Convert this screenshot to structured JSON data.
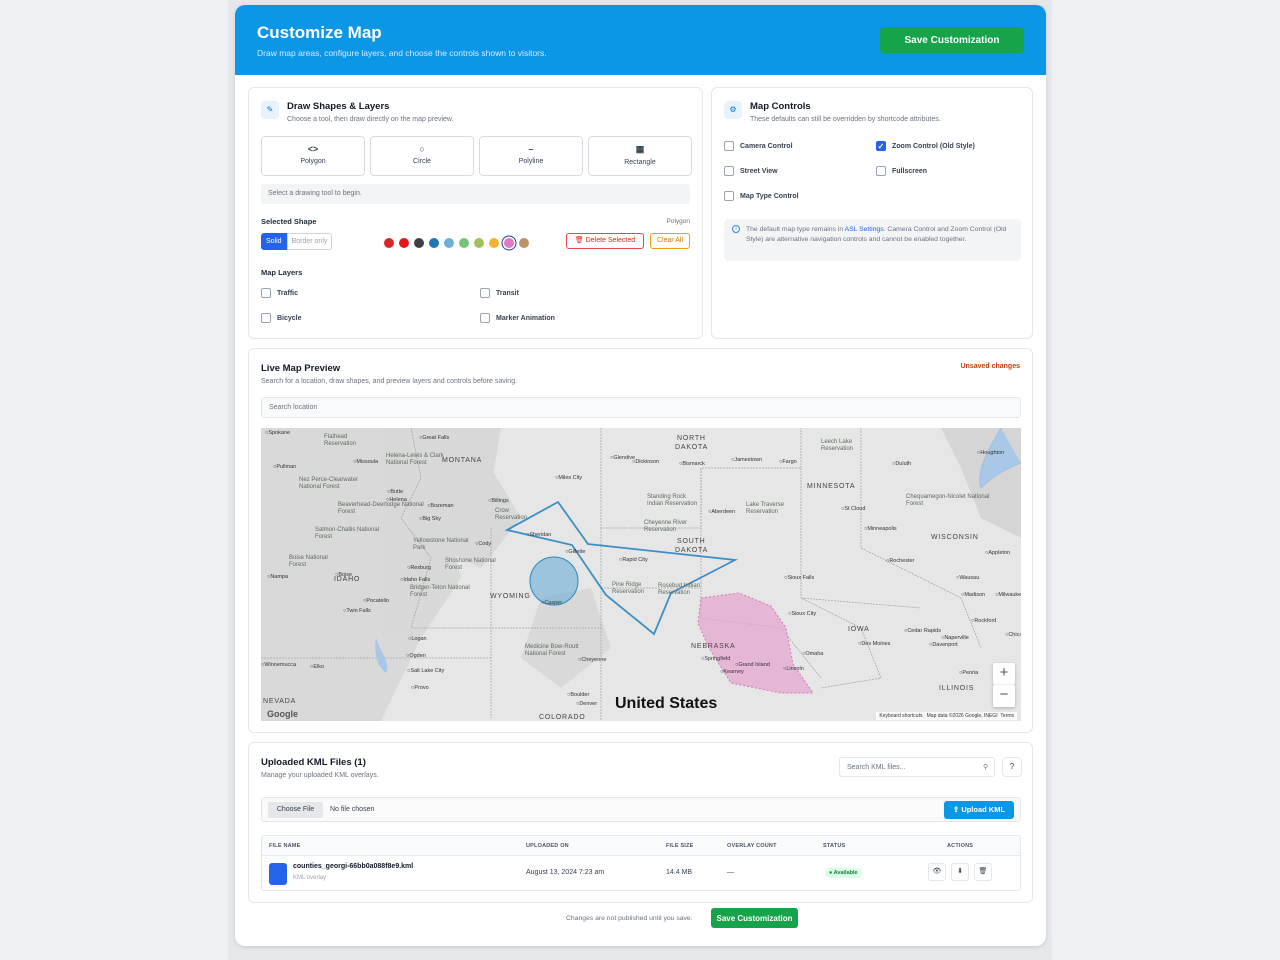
{
  "header": {
    "title": "Customize Map",
    "subtitle": "Draw map areas, configure layers, and choose the controls shown to visitors.",
    "save_label": "Save Customization"
  },
  "draw": {
    "title": "Draw Shapes & Layers",
    "subtitle": "Choose a tool, then draw directly on the map preview.",
    "tools": [
      {
        "label": "Polygon",
        "glyph": "<>"
      },
      {
        "label": "Circle",
        "glyph": "○"
      },
      {
        "label": "Polyline",
        "glyph": "–"
      },
      {
        "label": "Rectangle",
        "glyph": "▦"
      }
    ],
    "hint": "Select a drawing tool to begin.",
    "selected_shape_label": "Selected Shape",
    "selected_shape_value": "Polygon",
    "fill_solid": "Solid",
    "fill_border": "Border only",
    "swatches": [
      "#d62728",
      "#e31a1c",
      "#3f3f46",
      "#1f77b4",
      "#6baed6",
      "#74c476",
      "#a1c25a",
      "#f2b134",
      "#e377c2",
      "#b8946a"
    ],
    "delete_label": "Delete Selected",
    "clear_label": "Clear All",
    "layers_title": "Map Layers",
    "layers": [
      "Traffic",
      "Transit",
      "Bicycle",
      "Marker Animation"
    ]
  },
  "controls": {
    "title": "Map Controls",
    "subtitle": "These defaults can still be overridden by shortcode attributes.",
    "items": [
      {
        "label": "Camera Control",
        "checked": false
      },
      {
        "label": "Zoom Control (Old Style)",
        "checked": true
      },
      {
        "label": "Street View",
        "checked": false
      },
      {
        "label": "Fullscreen",
        "checked": false
      },
      {
        "label": "Map Type Control",
        "checked": false
      }
    ],
    "info_prefix": "The default map type remains in ",
    "info_link": "ASL Settings",
    "info_suffix": ". Camera Control and Zoom Control (Old Style) are alternative navigation controls and cannot be enabled together."
  },
  "preview": {
    "title": "Live Map Preview",
    "subtitle": "Search for a location, draw shapes, and preview layers and controls before saving.",
    "status": "Unsaved changes",
    "search_placeholder": "Search location",
    "map_labels": {
      "country": "United States",
      "states": [
        "MONTANA",
        "WYOMING",
        "IDAHO",
        "NORTH DAKOTA",
        "SOUTH DAKOTA",
        "MINNESOTA",
        "NEBRASKA",
        "IOWA",
        "WISCONSIN",
        "NEVADA",
        "COLORADO",
        "ILLINOIS"
      ],
      "cities": [
        "Spokane",
        "Great Falls",
        "Missoula",
        "Helena",
        "Billings",
        "Bozeman",
        "Sheridan",
        "Casper",
        "Rapid City",
        "Bismarck",
        "Fargo",
        "Minneapolis",
        "Sioux Falls",
        "Sioux City",
        "Omaha",
        "Lincoln",
        "Des Moines",
        "Boise",
        "Ogden",
        "Salt Lake City",
        "Cheyenne",
        "Denver",
        "Boulder",
        "Provo",
        "Pocatello",
        "Idaho Falls",
        "Duluth",
        "Madison",
        "Rochester",
        "Dickinson",
        "Jamestown",
        "Aberdeen",
        "Gillette",
        "Kearney",
        "Grand Island",
        "Peoria",
        "Rockford",
        "Cedar Rapids",
        "Davenport",
        "Appleton",
        "Miles City",
        "Glendive",
        "Butte",
        "Logan",
        "Elko",
        "Winnemucca",
        "Twin Falls",
        "Rexburg",
        "Cody",
        "Houghton",
        "Pullman",
        "Nampa",
        "Big Sky",
        "Springfield",
        "Naperville",
        "Wausau",
        "St Cloud",
        "Milwaukee",
        "Chicago"
      ],
      "features": [
        "Helena-Lewis & Clark National Forest",
        "Beaverhead-Deerlodge National Forest",
        "Salmon-Challis National Forest",
        "Boise National Forest",
        "Yellowstone National Park",
        "Shoshone National Forest",
        "Bridger-Teton National Forest",
        "Medicine Bow-Routt National Forest",
        "Chequamegon-Nicolet National Forest",
        "Pine Ridge Reservation",
        "Rosebud Indian Reservation",
        "Cheyenne River Reservation",
        "Standing Rock Indian Reservation",
        "Lake Traverse Reservation",
        "Leech Lake Reservation",
        "Crow Reservation",
        "Flathead Reservation",
        "Nez Perce-Clearwater National Forest"
      ]
    },
    "attribution": "Map data ©2026 Google, INEGI",
    "shortcuts": "Keyboard shortcuts",
    "terms": "Terms",
    "google": "Google"
  },
  "kml": {
    "title": "Uploaded KML Files (1)",
    "subtitle": "Manage your uploaded KML overlays.",
    "search_placeholder": "Search KML files...",
    "choose_label": "Choose File",
    "no_file": "No file chosen",
    "upload_label": "Upload KML",
    "columns": [
      "FILE NAME",
      "UPLOADED ON",
      "FILE SIZE",
      "OVERLAY COUNT",
      "STATUS",
      "ACTIONS"
    ],
    "rows": [
      {
        "name": "counties_georgi-66bb0a088f8e9.kml",
        "type": "KML overlay",
        "uploaded": "August 13, 2024 7:23 am",
        "size": "14.4 MB",
        "count": "—",
        "status": "● Available"
      }
    ]
  },
  "footer": {
    "note": "Changes are not published until you save.",
    "save_label": "Save Customization"
  }
}
